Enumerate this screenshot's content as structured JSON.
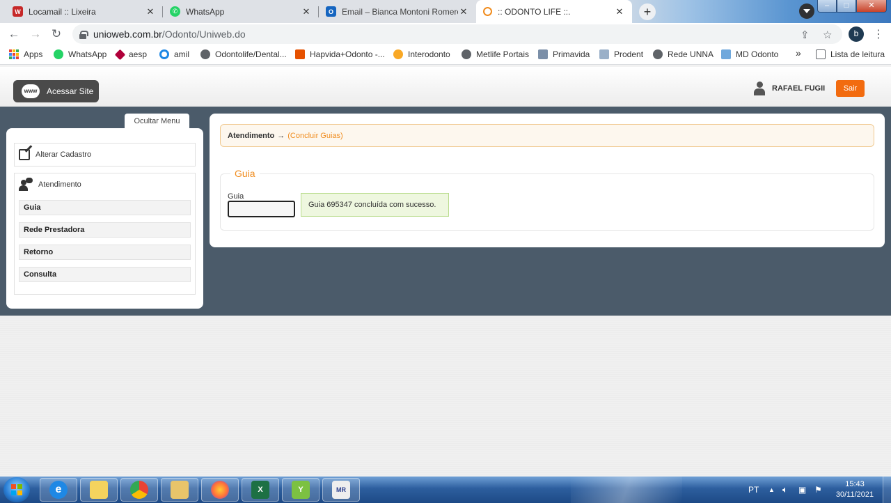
{
  "browser": {
    "tabs": [
      {
        "title": "Locamail :: Lixeira",
        "icon": "W",
        "icon_color": "#c62828"
      },
      {
        "title": "WhatsApp",
        "icon": "whatsapp-icon",
        "icon_color": "#25d366"
      },
      {
        "title": "Email – Bianca Montoni Romero",
        "icon": "O",
        "icon_color": "#1565c0"
      },
      {
        "title": ":: ODONTO LIFE ::.",
        "icon": "odonto-icon",
        "icon_color": "#f08c1e"
      }
    ],
    "close_glyph": "✕",
    "new_tab_glyph": "+",
    "url_host": "unioweb.com.br",
    "url_path": "/Odonto/Uniweb.do",
    "profile_initial": "b",
    "bookmarks": [
      {
        "label": "Apps",
        "color": "#4285f4"
      },
      {
        "label": "WhatsApp",
        "color": "#25d366"
      },
      {
        "label": "aesp",
        "color": "#b0003a"
      },
      {
        "label": "amil",
        "color": "#1e88e5"
      },
      {
        "label": "Odontolife/Dental...",
        "color": "#5f6368"
      },
      {
        "label": "Hapvida+Odonto -...",
        "color": "#e65100"
      },
      {
        "label": "Interodonto",
        "color": "#f9a825"
      },
      {
        "label": "Metlife Portais",
        "color": "#5f6368"
      },
      {
        "label": "Primavida",
        "color": "#7b8fa8"
      },
      {
        "label": "Prodent",
        "color": "#9ab0c8"
      },
      {
        "label": "Rede UNNA",
        "color": "#5f6368"
      },
      {
        "label": "MD Odonto",
        "color": "#6fa8dc"
      }
    ],
    "bookmarks_overflow": "»",
    "reading_list": "Lista de leitura"
  },
  "site": {
    "access_site_label": "Acessar Site",
    "www_label": "www",
    "user_name": "RAFAEL FUGII",
    "logout_label": "Sair",
    "hide_menu_label": "Ocultar Menu"
  },
  "sidebar": {
    "alterar_cadastro": "Alterar Cadastro",
    "atendimento": "Atendimento",
    "items": [
      "Guia",
      "Rede Prestadora",
      "Retorno",
      "Consulta"
    ]
  },
  "main": {
    "breadcrumb_main": "Atendimento",
    "breadcrumb_arrow": "→",
    "breadcrumb_sub": "(Concluir Guias)",
    "legend": "Guia",
    "field_label": "Guia",
    "field_value": "",
    "success_message": "Guia 695347 concluída com sucesso."
  },
  "taskbar": {
    "language": "PT",
    "time": "15:43",
    "date": "30/11/2021",
    "apps": [
      "internet-explorer",
      "windows-explorer",
      "chrome",
      "file-explorer",
      "firefox",
      "excel",
      "app-y",
      "mr-app"
    ]
  },
  "colors": {
    "accent_orange": "#f08c1e",
    "logout_orange": "#f26b0f",
    "dark_area": "#4b5b6a",
    "success_bg": "#eef7df"
  }
}
